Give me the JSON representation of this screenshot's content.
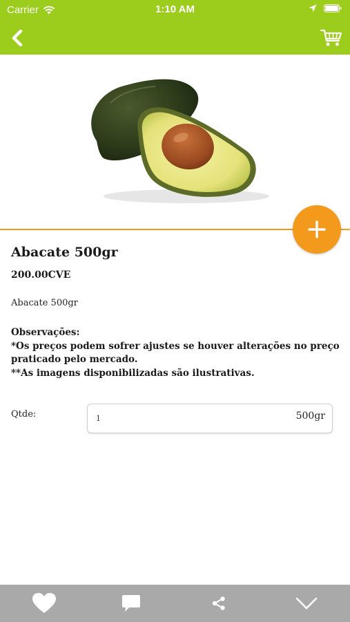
{
  "status_bar": {
    "carrier": "Carrier",
    "time": "1:10 AM"
  },
  "nav": {
    "back_icon": "chevron-left-icon",
    "cart_icon": "cart-icon"
  },
  "colors": {
    "brand_green": "#9ccc1c",
    "accent_orange": "#f39a1c",
    "bottom_bar": "#a9a9a9"
  },
  "product": {
    "title": "Abacate 500gr",
    "price": "200.00CVE",
    "description": "Abacate 500gr",
    "notes": {
      "heading": "Observações:",
      "line1": "*Os preços podem sofrer ajustes se houver alterações no preço praticado pelo mercado.",
      "line2": "**As imagens disponibilizadas são ilustrativas."
    }
  },
  "quantity": {
    "label": "Qtde:",
    "value": "1",
    "unit": "500gr"
  },
  "bottom_bar": {
    "items": [
      "heart-icon",
      "comment-icon",
      "share-icon",
      "chevron-down-icon"
    ]
  }
}
